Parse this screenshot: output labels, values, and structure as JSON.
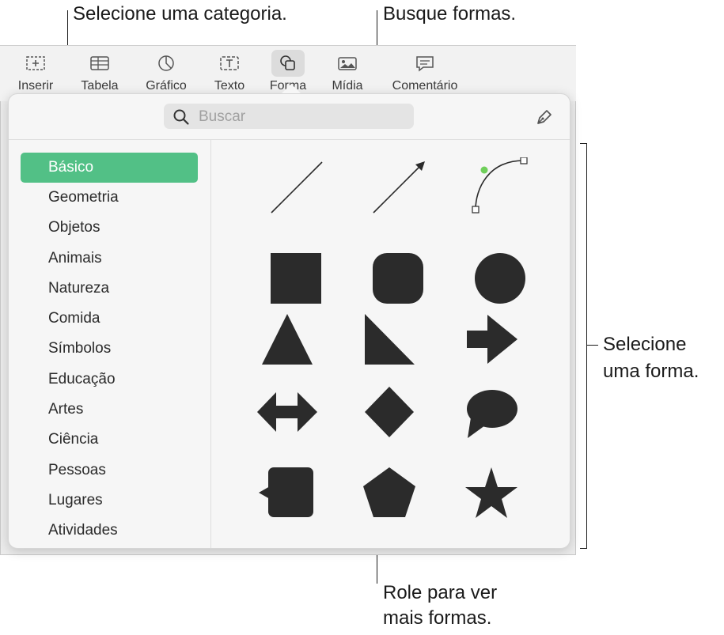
{
  "callouts": {
    "select_category": "Selecione uma categoria.",
    "search_shapes": "Busque formas.",
    "select_shape_line1": "Selecione",
    "select_shape_line2": "uma forma.",
    "scroll_line1": "Role para ver",
    "scroll_line2": "mais formas."
  },
  "toolbar": {
    "items": [
      {
        "label": "Inserir",
        "icon": "insert-icon"
      },
      {
        "label": "Tabela",
        "icon": "table-icon"
      },
      {
        "label": "Gráfico",
        "icon": "chart-icon"
      },
      {
        "label": "Texto",
        "icon": "text-box-icon"
      },
      {
        "label": "Forma",
        "icon": "shape-icon",
        "selected": true
      },
      {
        "label": "Mídia",
        "icon": "media-icon"
      },
      {
        "label": "Comentário",
        "icon": "comment-icon"
      }
    ]
  },
  "search": {
    "placeholder": "Buscar"
  },
  "categories": [
    "Básico",
    "Geometria",
    "Objetos",
    "Animais",
    "Natureza",
    "Comida",
    "Símbolos",
    "Educação",
    "Artes",
    "Ciência",
    "Pessoas",
    "Lugares",
    "Atividades"
  ],
  "selected_category": "Básico",
  "shapes": [
    "line",
    "arrow-line",
    "curve",
    "square",
    "rounded-square",
    "circle",
    "triangle",
    "right-triangle",
    "arrow",
    "double-arrow",
    "diamond",
    "speech-bubble",
    "callout-square",
    "pentagon",
    "star"
  ],
  "colors": {
    "accent": "#52c086",
    "shape_fill": "#2b2b2b",
    "curve_point": "#6fcf5a"
  }
}
